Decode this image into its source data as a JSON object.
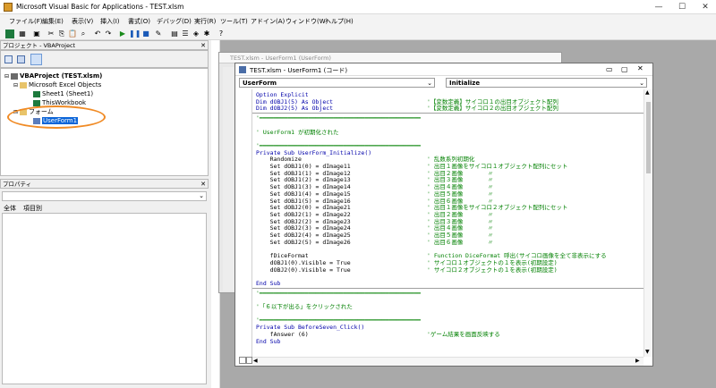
{
  "window": {
    "title": "Microsoft Visual Basic for Applications - TEST.xlsm",
    "controls": [
      "—",
      "☐",
      "✕"
    ]
  },
  "menu": [
    "ファイル(F)",
    "編集(E)",
    "表示(V)",
    "挿入(I)",
    "書式(O)",
    "デバッグ(D)",
    "実行(R)",
    "ツール(T)",
    "アドイン(A)",
    "ウィンドウ(W)",
    "ヘルプ(H)"
  ],
  "project": {
    "header": "プロジェクト - VBAProject",
    "root": "VBAProject (TEST.xlsm)",
    "folder_objects": "Microsoft Excel Objects",
    "sheet": "Sheet1 (Sheet1)",
    "workbook": "ThisWorkbook",
    "folder_forms": "フォーム",
    "form": "UserForm1"
  },
  "properties": {
    "header": "プロパティ",
    "tab_all": "全体",
    "tab_category": "項目別"
  },
  "bg_window": {
    "title": "TEST.xlsm - UserForm1 (UserForm)"
  },
  "code_window": {
    "title": "TEST.xlsm - UserForm1 (コード)",
    "object_combo": "UserForm",
    "proc_combo": "Initialize"
  },
  "code_lines": [
    {
      "t": "Option Explicit",
      "c": "kw"
    },
    {
      "t": "Dim dOBJ1(5) As Object",
      "c": "kw",
      "cm": "'【変数定義】サイコロ１の出目オブジェクト配列"
    },
    {
      "t": "Dim dOBJ2(5) As Object",
      "c": "kw",
      "cm": "'【変数定義】サイコロ２の出目オブジェクト配列"
    },
    {
      "sep": true
    },
    {
      "t": "'━━━━━━━━━━━━━━━━━━━━━━━━━━━━━━━━━━━━━━━━━━━━━━",
      "c": "cm"
    },
    {
      "t": "",
      "c": ""
    },
    {
      "t": "' UserForm1 が初期化された",
      "c": "cm"
    },
    {
      "t": "",
      "c": ""
    },
    {
      "t": "'━━━━━━━━━━━━━━━━━━━━━━━━━━━━━━━━━━━━━━━━━━━━━━",
      "c": "cm"
    },
    {
      "t": "Private Sub UserForm_Initialize()",
      "c": "kw"
    },
    {
      "t": "    Randomize",
      "c": "",
      "cm": "' 乱数系列初期化"
    },
    {
      "t": "    Set dOBJ1(0) = dImage11",
      "c": "",
      "cm": "' 出目１画像をサイコロ１オブジェクト配列にセット"
    },
    {
      "t": "    Set dOBJ1(1) = dImage12",
      "c": "",
      "cm": "' 出目２画像       〃"
    },
    {
      "t": "    Set dOBJ1(2) = dImage13",
      "c": "",
      "cm": "' 出目３画像       〃"
    },
    {
      "t": "    Set dOBJ1(3) = dImage14",
      "c": "",
      "cm": "' 出目４画像       〃"
    },
    {
      "t": "    Set dOBJ1(4) = dImage15",
      "c": "",
      "cm": "' 出目５画像       〃"
    },
    {
      "t": "    Set dOBJ1(5) = dImage16",
      "c": "",
      "cm": "' 出目６画像       〃"
    },
    {
      "t": "    Set dOBJ2(0) = dImage21",
      "c": "",
      "cm": "' 出目１画像をサイコロ２オブジェクト配列にセット"
    },
    {
      "t": "    Set dOBJ2(1) = dImage22",
      "c": "",
      "cm": "' 出目２画像       〃"
    },
    {
      "t": "    Set dOBJ2(2) = dImage23",
      "c": "",
      "cm": "' 出目３画像       〃"
    },
    {
      "t": "    Set dOBJ2(3) = dImage24",
      "c": "",
      "cm": "' 出目４画像       〃"
    },
    {
      "t": "    Set dOBJ2(4) = dImage25",
      "c": "",
      "cm": "' 出目５画像       〃"
    },
    {
      "t": "    Set dOBJ2(5) = dImage26",
      "c": "",
      "cm": "' 出目６画像       〃"
    },
    {
      "t": "",
      "c": ""
    },
    {
      "t": "    fDiceFormat",
      "c": "",
      "cm": "' Function DiceFormat 呼出(サイコロ画像を全て非表示にする"
    },
    {
      "t": "    dOBJ1(0).Visible = True",
      "c": "",
      "cm": "' サイコロ１オブジェクトの１を表示(初期設定)"
    },
    {
      "t": "    dOBJ2(0).Visible = True",
      "c": "",
      "cm": "' サイコロ２オブジェクトの１を表示(初期設定)"
    },
    {
      "t": "",
      "c": ""
    },
    {
      "t": "End Sub",
      "c": "kw"
    },
    {
      "sep": true
    },
    {
      "t": "'━━━━━━━━━━━━━━━━━━━━━━━━━━━━━━━━━━━━━━━━━━━━━━",
      "c": "cm"
    },
    {
      "t": "",
      "c": ""
    },
    {
      "t": "'「６以下が出る」をクリックされた",
      "c": "cm"
    },
    {
      "t": "",
      "c": ""
    },
    {
      "t": "'━━━━━━━━━━━━━━━━━━━━━━━━━━━━━━━━━━━━━━━━━━━━━━",
      "c": "cm"
    },
    {
      "t": "Private Sub BeforeSeven_Click()",
      "c": "kw"
    },
    {
      "t": "    fAnswer (6)",
      "c": "",
      "cm": "'ゲーム結果を画面反映する"
    },
    {
      "t": "End Sub",
      "c": "kw"
    }
  ]
}
